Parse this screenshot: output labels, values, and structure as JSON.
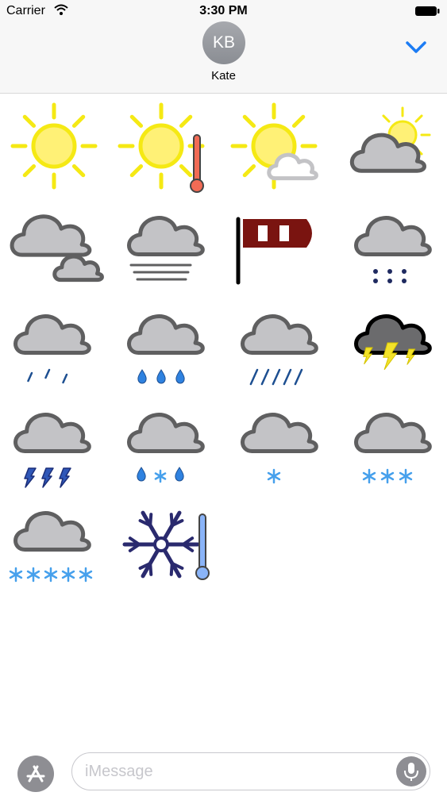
{
  "status_bar": {
    "carrier": "Carrier",
    "time": "3:30 PM",
    "wifi_icon": "wifi-icon",
    "battery_icon": "battery-icon"
  },
  "header": {
    "avatar_initials": "KB",
    "contact_name": "Kate",
    "collapse_icon": "chevron-down-icon"
  },
  "stickers": [
    {
      "icon": "sunny"
    },
    {
      "icon": "sunny-hot"
    },
    {
      "icon": "sunny-with-cloud"
    },
    {
      "icon": "partly-cloudy"
    },
    {
      "icon": "cloudy"
    },
    {
      "icon": "fog"
    },
    {
      "icon": "windy"
    },
    {
      "icon": "light-snow"
    },
    {
      "icon": "light-rain"
    },
    {
      "icon": "rain-showers"
    },
    {
      "icon": "heavy-rain"
    },
    {
      "icon": "thunderstorm"
    },
    {
      "icon": "hail"
    },
    {
      "icon": "sleet"
    },
    {
      "icon": "snow-flurry"
    },
    {
      "icon": "snow"
    },
    {
      "icon": "heavy-snow"
    },
    {
      "icon": "freezing-cold"
    }
  ],
  "input_bar": {
    "app_store_icon": "app-store-icon",
    "placeholder": "iMessage",
    "mic_icon": "microphone-icon"
  },
  "colors": {
    "accent": "#1c7cf4",
    "sun": "#fff176",
    "sun_ray": "#f5e914",
    "cloud_fill": "#c3c3c6",
    "cloud_stroke": "#5f5f60",
    "rain": "#1d4f91",
    "drop": "#2f82e0",
    "snow": "#46a0ec",
    "storm_bolt": "#f2e22a",
    "storm_cloud": "#6b6b6d",
    "thermometer_hot": "#f26b55",
    "thermometer_cold": "#8ab4f8",
    "snowflake": "#2a2a6e",
    "windsock": "#7a1410"
  }
}
